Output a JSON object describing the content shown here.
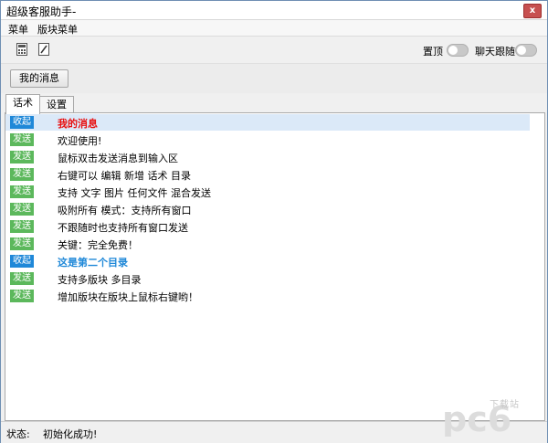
{
  "window": {
    "title": "超级客服助手-",
    "close_glyph": "x"
  },
  "menu": {
    "items": [
      "菜单",
      "版块菜单"
    ]
  },
  "toolbar": {
    "toggles": [
      {
        "label": "置顶",
        "on": false
      },
      {
        "label": "聊天跟随",
        "on": false
      }
    ]
  },
  "msgbar": {
    "button_label": "我的消息"
  },
  "tabs": [
    {
      "label": "话术",
      "active": true
    },
    {
      "label": "设置",
      "active": false
    }
  ],
  "rows": [
    {
      "badge": "收起",
      "text": "我的消息"
    },
    {
      "badge": "发送",
      "text": "欢迎使用!"
    },
    {
      "badge": "发送",
      "text": "鼠标双击发送消息到输入区"
    },
    {
      "badge": "发送",
      "text": "右键可以 编辑 新增 话术 目录"
    },
    {
      "badge": "发送",
      "text": "支持 文字 图片 任何文件 混合发送"
    },
    {
      "badge": "发送",
      "text": "吸附所有 模式：支持所有窗口"
    },
    {
      "badge": "发送",
      "text": "不跟随时也支持所有窗口发送"
    },
    {
      "badge": "发送",
      "text": "关键：完全免费！"
    },
    {
      "badge": "收起",
      "text": "这是第二个目录"
    },
    {
      "badge": "发送",
      "text": "支持多版块 多目录"
    },
    {
      "badge": "发送",
      "text": "增加版块在版块上鼠标右键哟！"
    }
  ],
  "status": {
    "label": "状态:",
    "text": "初始化成功!"
  },
  "watermark": {
    "logo": "pc6",
    "sub": "下载站"
  },
  "colors": {
    "collapse": "#1f88d8",
    "send": "#5cb85c",
    "category_red": "#e81010",
    "category_blue": "#1f88d8"
  }
}
